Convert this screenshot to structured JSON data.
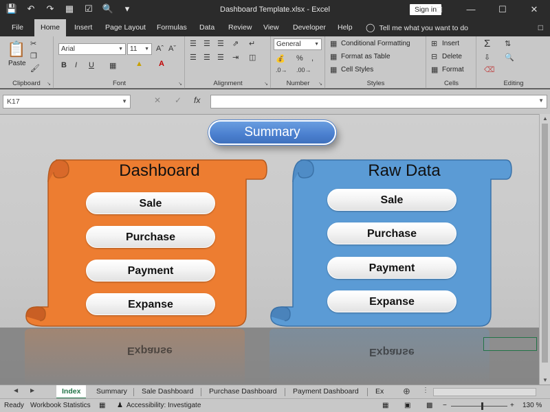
{
  "window": {
    "title": "Dashboard Template.xlsx  -  Excel",
    "sign_in": "Sign in",
    "qat_icons": [
      "save-icon",
      "undo-icon",
      "redo-icon",
      "form-icon",
      "checkbox-icon",
      "print-preview-icon",
      "customize-icon"
    ]
  },
  "tabs": [
    "File",
    "Home",
    "Insert",
    "Page Layout",
    "Formulas",
    "Data",
    "Review",
    "View",
    "Developer",
    "Help"
  ],
  "active_tab": "Home",
  "tell_me": "Tell me what you want to do",
  "ribbon": {
    "clipboard": {
      "label": "Clipboard",
      "paste": "Paste"
    },
    "font": {
      "label": "Font",
      "name": "Arial",
      "size": "11",
      "bold": "B",
      "italic": "I",
      "underline": "U"
    },
    "alignment": {
      "label": "Alignment"
    },
    "number": {
      "label": "Number",
      "format": "General",
      "percent": "%"
    },
    "styles": {
      "label": "Styles",
      "conditional": "Conditional Formatting",
      "as_table": "Format as Table",
      "cell_styles": "Cell Styles"
    },
    "cells": {
      "label": "Cells",
      "insert": "Insert",
      "delete": "Delete",
      "format": "Format"
    },
    "editing": {
      "label": "Editing"
    }
  },
  "formula_bar": {
    "name_box": "K17",
    "fx": "fx",
    "value": ""
  },
  "sheet": {
    "summary_button": "Summary",
    "dashboard": {
      "title": "Dashboard",
      "color": "#ed7d31",
      "items": [
        "Sale",
        "Purchase",
        "Payment",
        "Expanse"
      ]
    },
    "raw_data": {
      "title": "Raw Data",
      "color": "#5b9bd5",
      "items": [
        "Sale",
        "Purchase",
        "Payment",
        "Expanse"
      ]
    }
  },
  "sheet_tabs": [
    "Index",
    "Summary",
    "Sale Dashboard",
    "Purchase Dashboard",
    "Payment Dashboard",
    "Ex"
  ],
  "active_sheet": "Index",
  "status": {
    "ready": "Ready",
    "workbook_stats": "Workbook Statistics",
    "accessibility": "Accessibility: Investigate",
    "zoom": "130 %"
  }
}
